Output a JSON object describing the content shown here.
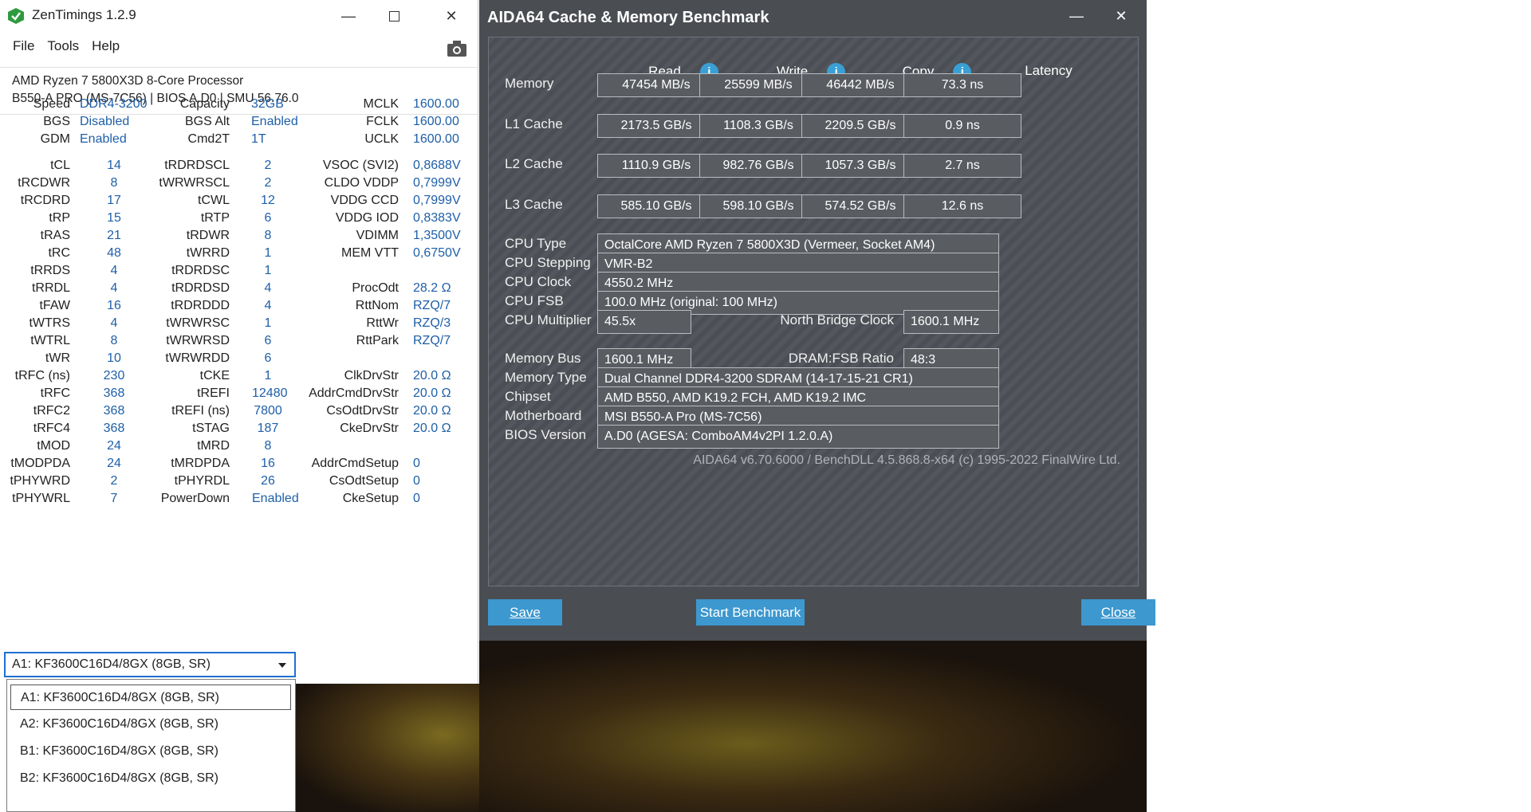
{
  "zen": {
    "title": "ZenTimings 1.2.9",
    "menu": [
      "File",
      "Tools",
      "Help"
    ],
    "cpu": "AMD Ryzen 7 5800X3D 8-Core Processor",
    "board": "B550-A PRO (MS-7C56) | BIOS A.D0 | SMU 56.76.0",
    "top": [
      [
        "Speed",
        "DDR4-3200",
        "Capacity",
        "32GB",
        "MCLK",
        "1600.00"
      ],
      [
        "BGS",
        "Disabled",
        "BGS Alt",
        "Enabled",
        "FCLK",
        "1600.00"
      ],
      [
        "GDM",
        "Enabled",
        "Cmd2T",
        "1T",
        "UCLK",
        "1600.00"
      ]
    ],
    "timings": [
      [
        "tCL",
        "14",
        "tRDRDSCL",
        "2",
        "VSOC (SVI2)",
        "0,8688V"
      ],
      [
        "tRCDWR",
        "8",
        "tWRWRSCL",
        "2",
        "CLDO VDDP",
        "0,7999V"
      ],
      [
        "tRCDRD",
        "17",
        "tCWL",
        "12",
        "VDDG CCD",
        "0,7999V"
      ],
      [
        "tRP",
        "15",
        "tRTP",
        "6",
        "VDDG IOD",
        "0,8383V"
      ],
      [
        "tRAS",
        "21",
        "tRDWR",
        "8",
        "VDIMM",
        "1,3500V"
      ],
      [
        "tRC",
        "48",
        "tWRRD",
        "1",
        "MEM VTT",
        "0,6750V"
      ],
      [
        "tRRDS",
        "4",
        "tRDRDSC",
        "1",
        "",
        ""
      ],
      [
        "tRRDL",
        "4",
        "tRDRDSD",
        "4",
        "ProcOdt",
        "28.2 Ω"
      ],
      [
        "tFAW",
        "16",
        "tRDRDDD",
        "4",
        "RttNom",
        "RZQ/7"
      ],
      [
        "tWTRS",
        "4",
        "tWRWRSC",
        "1",
        "RttWr",
        "RZQ/3"
      ],
      [
        "tWTRL",
        "8",
        "tWRWRSD",
        "6",
        "RttPark",
        "RZQ/7"
      ],
      [
        "tWR",
        "10",
        "tWRWRDD",
        "6",
        "",
        ""
      ],
      [
        "tRFC (ns)",
        "230",
        "tCKE",
        "1",
        "ClkDrvStr",
        "20.0 Ω"
      ],
      [
        "tRFC",
        "368",
        "tREFI",
        "12480",
        "AddrCmdDrvStr",
        "20.0 Ω"
      ],
      [
        "tRFC2",
        "368",
        "tREFI (ns)",
        "7800",
        "CsOdtDrvStr",
        "20.0 Ω"
      ],
      [
        "tRFC4",
        "368",
        "tSTAG",
        "187",
        "CkeDrvStr",
        "20.0 Ω"
      ],
      [
        "tMOD",
        "24",
        "tMRD",
        "8",
        "",
        ""
      ],
      [
        "tMODPDA",
        "24",
        "tMRDPDA",
        "16",
        "AddrCmdSetup",
        "0"
      ],
      [
        "tPHYWRD",
        "2",
        "tPHYRDL",
        "26",
        "CsOdtSetup",
        "0"
      ],
      [
        "tPHYWRL",
        "7",
        "PowerDown",
        "Enabled",
        "CkeSetup",
        "0"
      ]
    ],
    "selected_module": "A1: KF3600C16D4/8GX (8GB, SR)",
    "modules": [
      "A1: KF3600C16D4/8GX (8GB, SR)",
      "A2: KF3600C16D4/8GX (8GB, SR)",
      "B1: KF3600C16D4/8GX (8GB, SR)",
      "B2: KF3600C16D4/8GX (8GB, SR)"
    ]
  },
  "aida": {
    "title": "AIDA64 Cache & Memory Benchmark",
    "headers": [
      "Read",
      "Write",
      "Copy",
      "Latency"
    ],
    "rows": [
      {
        "label": "Memory",
        "read": "47454 MB/s",
        "write": "25599 MB/s",
        "copy": "46442 MB/s",
        "latency": "73.3 ns"
      },
      {
        "label": "L1 Cache",
        "read": "2173.5 GB/s",
        "write": "1108.3 GB/s",
        "copy": "2209.5 GB/s",
        "latency": "0.9 ns"
      },
      {
        "label": "L2 Cache",
        "read": "1110.9 GB/s",
        "write": "982.76 GB/s",
        "copy": "1057.3 GB/s",
        "latency": "2.7 ns"
      },
      {
        "label": "L3 Cache",
        "read": "585.10 GB/s",
        "write": "598.10 GB/s",
        "copy": "574.52 GB/s",
        "latency": "12.6 ns"
      }
    ],
    "cpu_type_label": "CPU Type",
    "cpu_type": "OctalCore AMD Ryzen 7 5800X3D  (Vermeer, Socket AM4)",
    "cpu_stepping_label": "CPU Stepping",
    "cpu_stepping": "VMR-B2",
    "cpu_clock_label": "CPU Clock",
    "cpu_clock": "4550.2 MHz",
    "cpu_fsb_label": "CPU FSB",
    "cpu_fsb": "100.0 MHz  (original: 100 MHz)",
    "cpu_mult_label": "CPU Multiplier",
    "cpu_mult": "45.5x",
    "nb_clock_label": "North Bridge Clock",
    "nb_clock": "1600.1 MHz",
    "mem_bus_label": "Memory Bus",
    "mem_bus": "1600.1 MHz",
    "dram_ratio_label": "DRAM:FSB Ratio",
    "dram_ratio": "48:3",
    "mem_type_label": "Memory Type",
    "mem_type": "Dual Channel DDR4-3200 SDRAM  (14-17-15-21 CR1)",
    "chipset_label": "Chipset",
    "chipset": "AMD B550, AMD K19.2 FCH, AMD K19.2 IMC",
    "mobo_label": "Motherboard",
    "mobo": "MSI B550-A Pro (MS-7C56)",
    "bios_label": "BIOS Version",
    "bios": "A.D0  (AGESA: ComboAM4v2PI 1.2.0.A)",
    "footer": "AIDA64 v6.70.6000 / BenchDLL 4.5.868.8-x64  (c) 1995-2022 FinalWire Ltd.",
    "save": "Save",
    "start": "Start Benchmark",
    "close": "Close"
  },
  "colors": {
    "zen_value": "#1e5fa8",
    "aida_bg": "#4a4d52",
    "aida_button": "#3c98cf",
    "info_icon": "#39a0d6"
  },
  "icons": [
    "zentimings-logo-icon",
    "camera-icon",
    "minimize-icon",
    "maximize-icon",
    "close-icon",
    "info-icon",
    "dropdown-arrow-icon"
  ]
}
